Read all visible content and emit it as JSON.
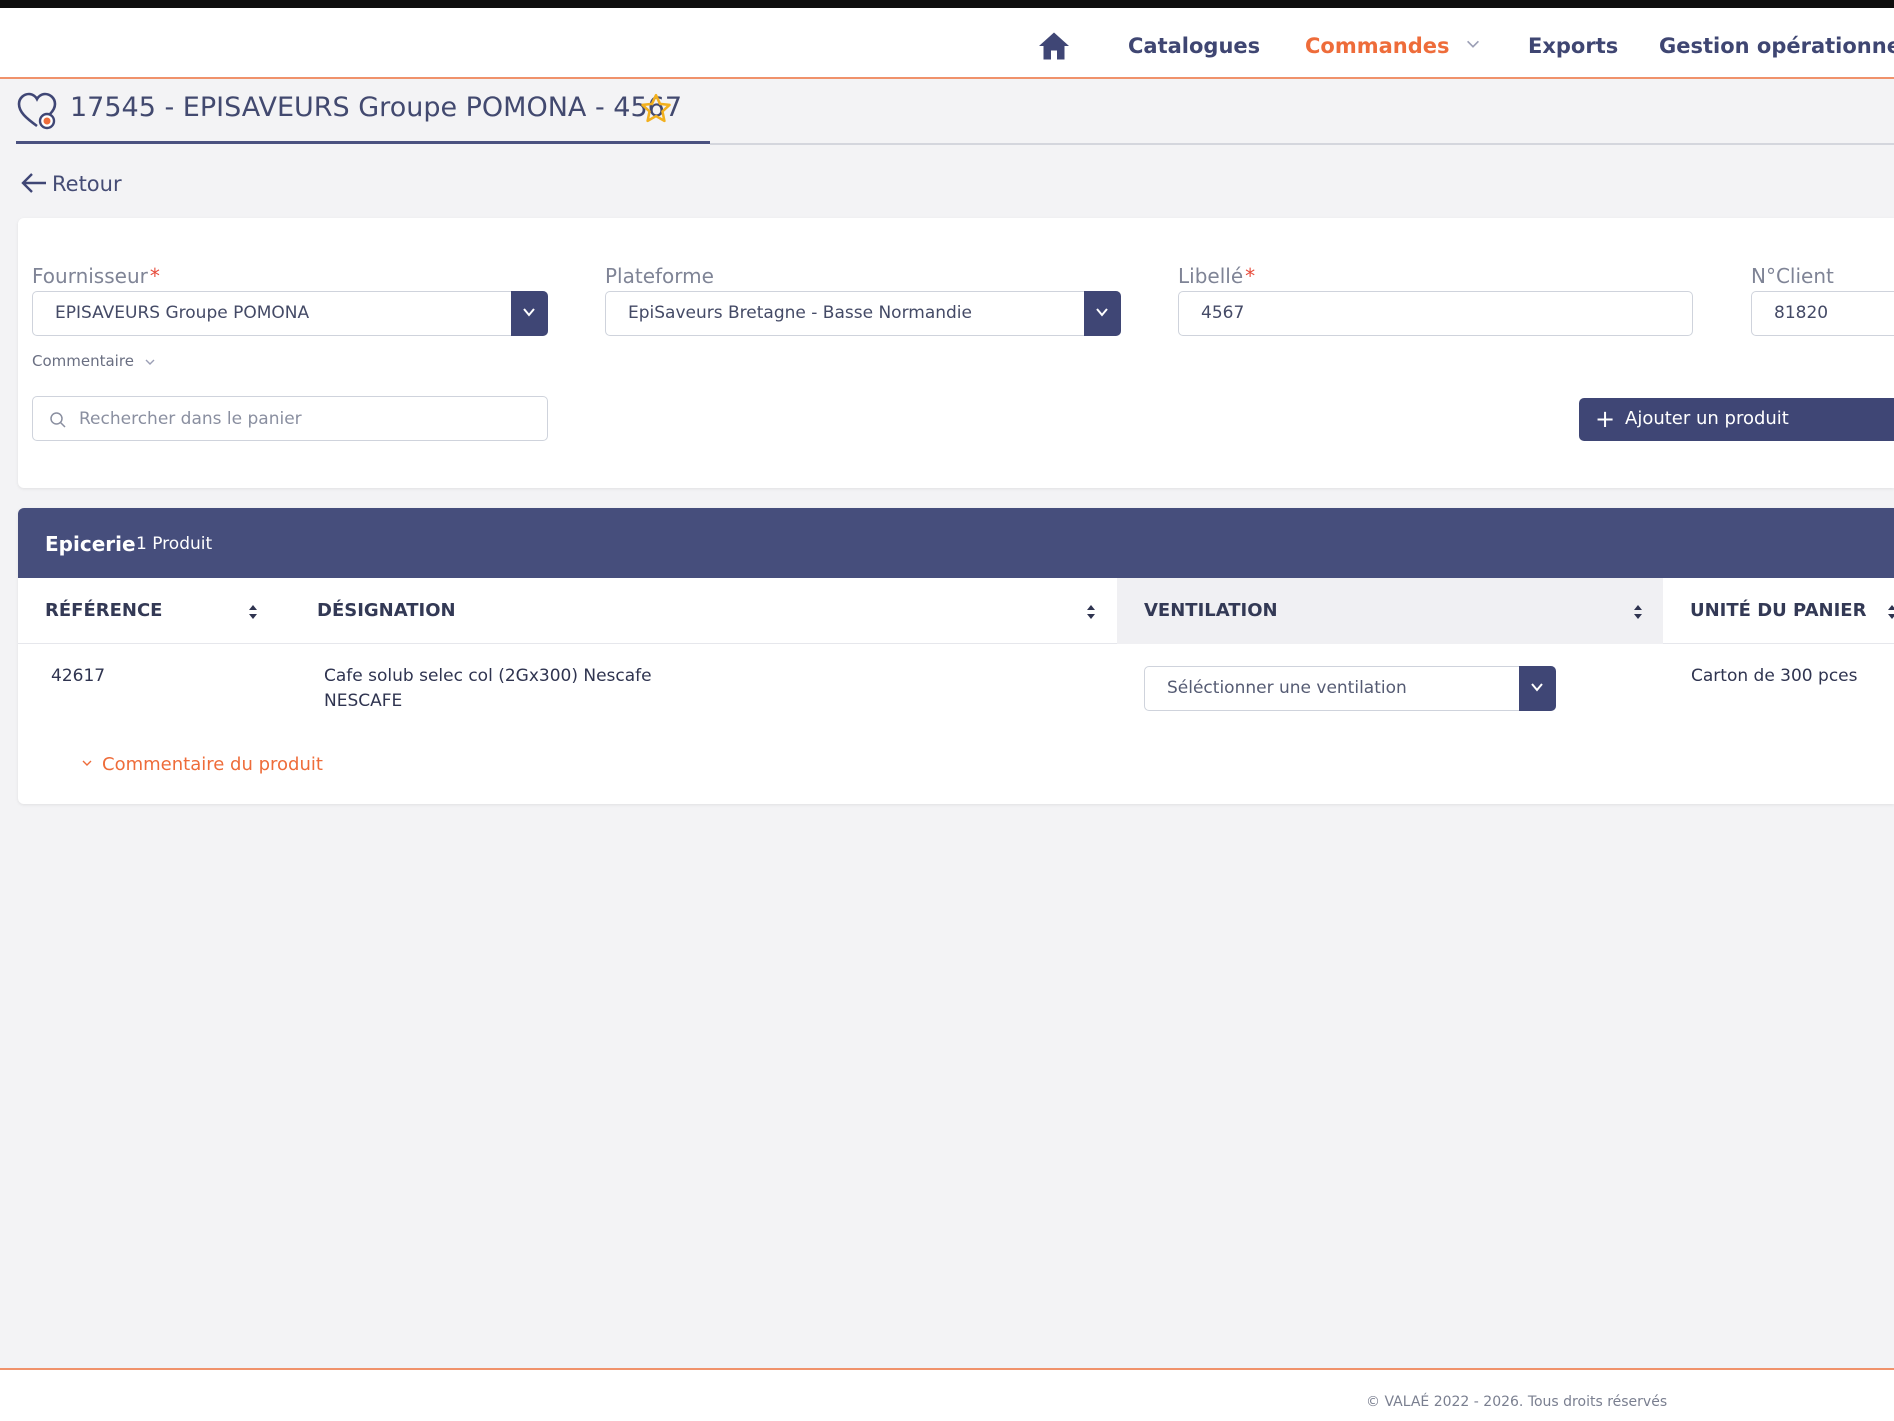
{
  "nav": {
    "items": [
      {
        "label": "Catalogues"
      },
      {
        "label": "Commandes"
      },
      {
        "label": "Exports"
      },
      {
        "label": "Gestion opérationnelle"
      }
    ]
  },
  "header": {
    "title": "17545 - EPISAVEURS Groupe POMONA - 4567"
  },
  "back": {
    "label": "Retour"
  },
  "form": {
    "fournisseur": {
      "label": "Fournisseur",
      "value": "EPISAVEURS Groupe POMONA"
    },
    "plateforme": {
      "label": "Plateforme",
      "value": "EpiSaveurs Bretagne - Basse Normandie"
    },
    "libelle": {
      "label": "Libellé",
      "value": "4567"
    },
    "noclient": {
      "label": "N°Client",
      "value": "81820"
    },
    "required_mark": "*",
    "commentaire_label": "Commentaire",
    "search_placeholder": "Rechercher dans le panier",
    "add_button": "Ajouter un produit"
  },
  "group": {
    "name": "Epicerie",
    "count": "1 Produit",
    "columns": [
      "RÉFÉRENCE",
      "DÉSIGNATION",
      "VENTILATION",
      "UNITÉ DU PANIER"
    ],
    "rows": [
      {
        "reference": "42617",
        "designation": "Cafe solub selec col (2Gx300) Nescafe",
        "brand": "NESCAFE",
        "ventilation_placeholder": "Séléctionner une ventilation",
        "unite": "Carton de 300 pces",
        "comment_label": "Commentaire du produit"
      }
    ]
  },
  "footer": {
    "copyright": "© VALAÉ 2022 - 2026. Tous droits réservés"
  },
  "colors": {
    "primary": "#3f4675",
    "accent": "#ee6c3a",
    "group_header": "#464e7c",
    "background": "#f3f3f5",
    "required": "#e74c3c"
  },
  "icons": [
    "home-icon",
    "chevron-down-icon",
    "cart-heart-icon",
    "star-icon",
    "arrow-left-icon",
    "search-icon",
    "plus-icon",
    "sort-icon"
  ]
}
